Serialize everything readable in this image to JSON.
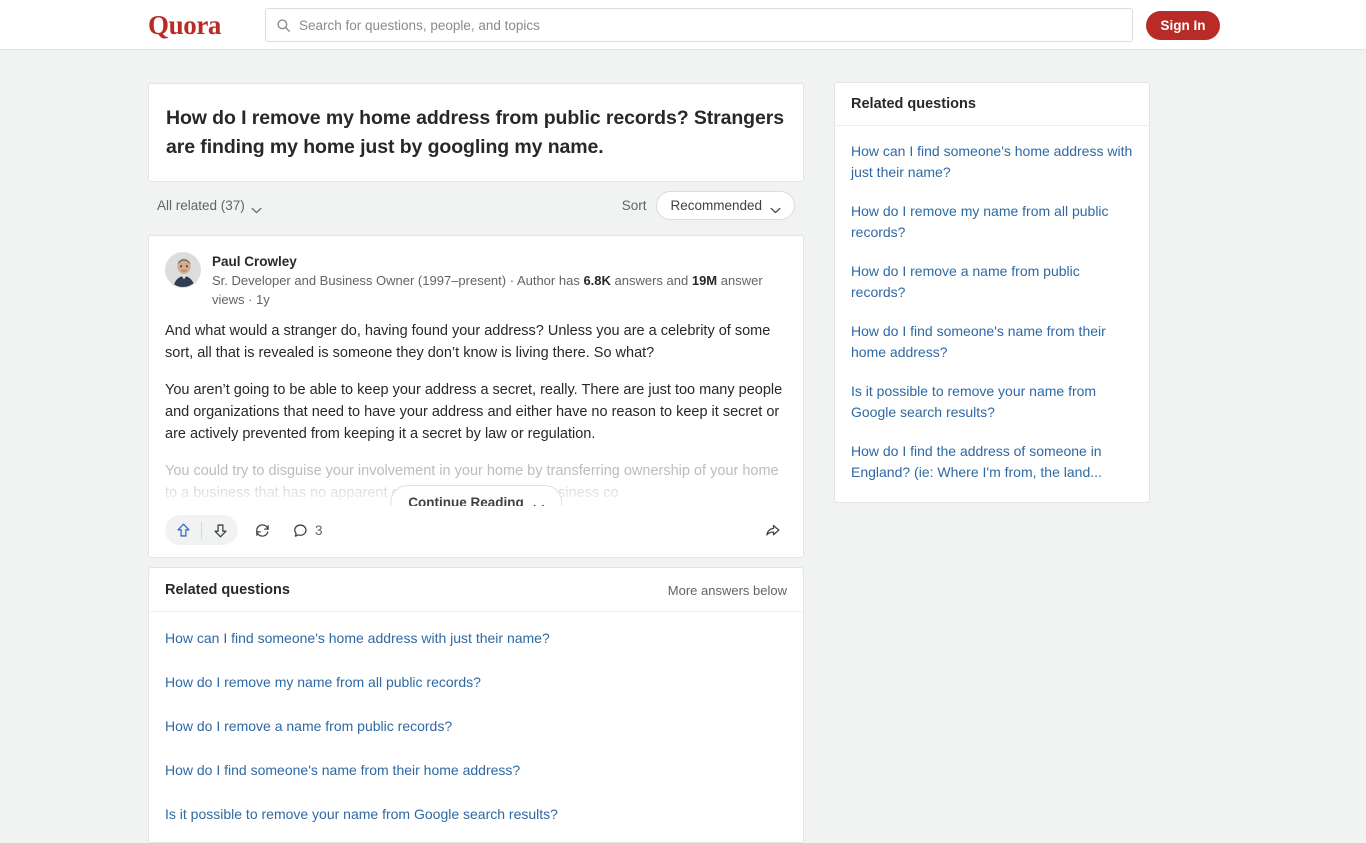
{
  "brand": {
    "logo_text": "Quora",
    "accent_color": "#b92b27",
    "link_color": "#2e69a4",
    "page_bg": "#f1f2f2"
  },
  "topbar": {
    "search": {
      "placeholder": "Search for questions, people, and topics",
      "value": "",
      "icon": "search-icon"
    },
    "signin_label": "Sign In"
  },
  "question": {
    "title": "How do I remove my home address from public records? Strangers are finding my home just by googling my name."
  },
  "filters": {
    "all_related_label": "All related (37)",
    "sort_label": "Sort",
    "sort_value": "Recommended"
  },
  "answer": {
    "author": {
      "name": "Paul Crowley",
      "credential_prefix": "Sr. Developer and Business Owner (1997–present) · Author has ",
      "answers_count": "6.8K",
      "credential_mid": " answers and ",
      "views_count": "19M",
      "credential_suffix": " answer views · 1y"
    },
    "paragraphs": [
      "And what would a stranger do, having found your address? Unless you are a celebrity of some sort, all that is revealed is someone they don’t know is living there. So what?",
      "You aren’t going to be able to keep your address a secret, really. There are just too many people and organizations that need to have your address and either have no reason to keep it secret or are actively prevented from keeping it a secret by law or regulation."
    ],
    "truncated_paragraph": "You could try to disguise your involvement in your home by transferring ownership of your home to a business that has no apparent connection to you. The business co",
    "continue_reading_label": "Continue Reading",
    "actions": {
      "upvote_icon": "upvote-arrow-icon",
      "downvote_icon": "downvote-arrow-icon",
      "repost_icon": "repost-cycle-icon",
      "comment_icon": "comment-bubble-icon",
      "comment_count": "3",
      "share_icon": "share-arrow-icon"
    }
  },
  "main_related": {
    "title": "Related questions",
    "more_answers_label": "More answers below",
    "items": [
      "How can I find someone's home address with just their name?",
      "How do I remove my name from all public records?",
      "How do I remove a name from public records?",
      "How do I find someone's name from their home address?",
      "Is it possible to remove your name from Google search results?"
    ]
  },
  "sidebar_related": {
    "title": "Related questions",
    "items": [
      "How can I find someone's home address with just their name?",
      "How do I remove my name from all public records?",
      "How do I remove a name from public records?",
      "How do I find someone's name from their home address?",
      "Is it possible to remove your name from Google search results?",
      "How do I find the address of someone in England? (ie: Where I'm from, the land..."
    ]
  }
}
